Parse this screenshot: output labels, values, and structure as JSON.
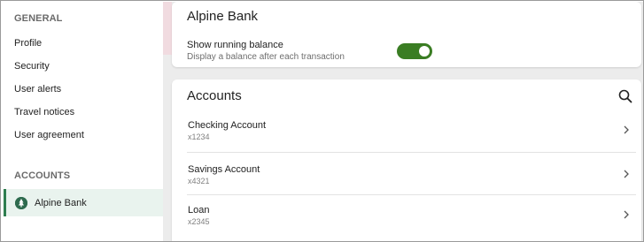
{
  "sidebar": {
    "general_title": "GENERAL",
    "items": [
      {
        "label": "Profile"
      },
      {
        "label": "Security"
      },
      {
        "label": "User alerts"
      },
      {
        "label": "Travel notices"
      },
      {
        "label": "User agreement"
      }
    ],
    "accounts_title": "ACCOUNTS",
    "active_account": {
      "label": "Alpine Bank",
      "icon": "alpine-bank-logo"
    }
  },
  "bank_card": {
    "title": "Alpine Bank",
    "setting_label": "Show running balance",
    "setting_desc": "Display a balance after each transaction",
    "toggle_on": true
  },
  "accounts_card": {
    "title": "Accounts",
    "rows": [
      {
        "name": "Checking Account",
        "number": "x1234"
      },
      {
        "name": "Savings Account",
        "number": "x4321"
      },
      {
        "name": "Loan",
        "number": "x2345"
      }
    ]
  },
  "colors": {
    "accent_green": "#3a7d23",
    "active_bg": "#e9f3ee",
    "active_border": "#2e7d4f"
  }
}
